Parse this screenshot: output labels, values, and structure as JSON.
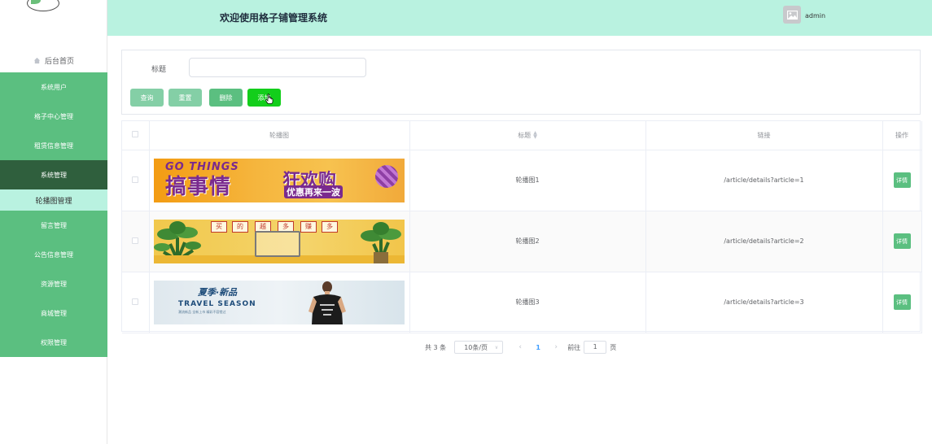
{
  "app": {
    "title": "欢迎使用格子铺管理系统",
    "user": "admin"
  },
  "sidebar": {
    "home": "后台首页",
    "items": [
      {
        "label": "系统用户",
        "state": "normal"
      },
      {
        "label": "格子中心管理",
        "state": "normal"
      },
      {
        "label": "租赁信息管理",
        "state": "normal"
      },
      {
        "label": "系统管理",
        "state": "active"
      },
      {
        "label": "轮播图管理",
        "state": "sub-selected"
      },
      {
        "label": "留言管理",
        "state": "normal"
      },
      {
        "label": "公告信息管理",
        "state": "normal"
      },
      {
        "label": "资源管理",
        "state": "normal"
      },
      {
        "label": "商城管理",
        "state": "normal"
      },
      {
        "label": "权限管理",
        "state": "normal"
      }
    ]
  },
  "search": {
    "label": "标题",
    "value": "",
    "placeholder": ""
  },
  "toolbar": {
    "query": "查询",
    "reset": "重置",
    "delete": "删除",
    "add": "添加"
  },
  "table": {
    "columns": [
      "轮播图",
      "标题",
      "链接",
      "操作"
    ],
    "sortable_column": "标题",
    "rows": [
      {
        "title": "轮播图1",
        "link": "/article/details?article=1",
        "action": "详情",
        "image": {
          "line1": "GO THINGS",
          "line2": "搞事情",
          "line3": "狂欢购",
          "line4": "优惠再来一波"
        }
      },
      {
        "title": "轮播图2",
        "link": "/article/details?article=2",
        "action": "详情",
        "image": {
          "tags": [
            "买",
            "的",
            "越",
            "多",
            "赚",
            "多"
          ]
        }
      },
      {
        "title": "轮播图3",
        "link": "/article/details?article=3",
        "action": "详情",
        "image": {
          "line1": "夏季·新品",
          "line2": "TRAVEL SEASON",
          "line3": "潮流新品 全新上市 精彩不容错过"
        }
      }
    ]
  },
  "pagination": {
    "total": "共 3 条",
    "page_size": "10条/页",
    "current_page": "1",
    "goto_prefix": "前往",
    "goto_value": "1",
    "goto_suffix": "页"
  },
  "colors": {
    "header_bg": "#b9f2e0",
    "menu_bg": "#5bbf80",
    "menu_active": "#2f5f3d",
    "add_button": "#13ce1b"
  }
}
